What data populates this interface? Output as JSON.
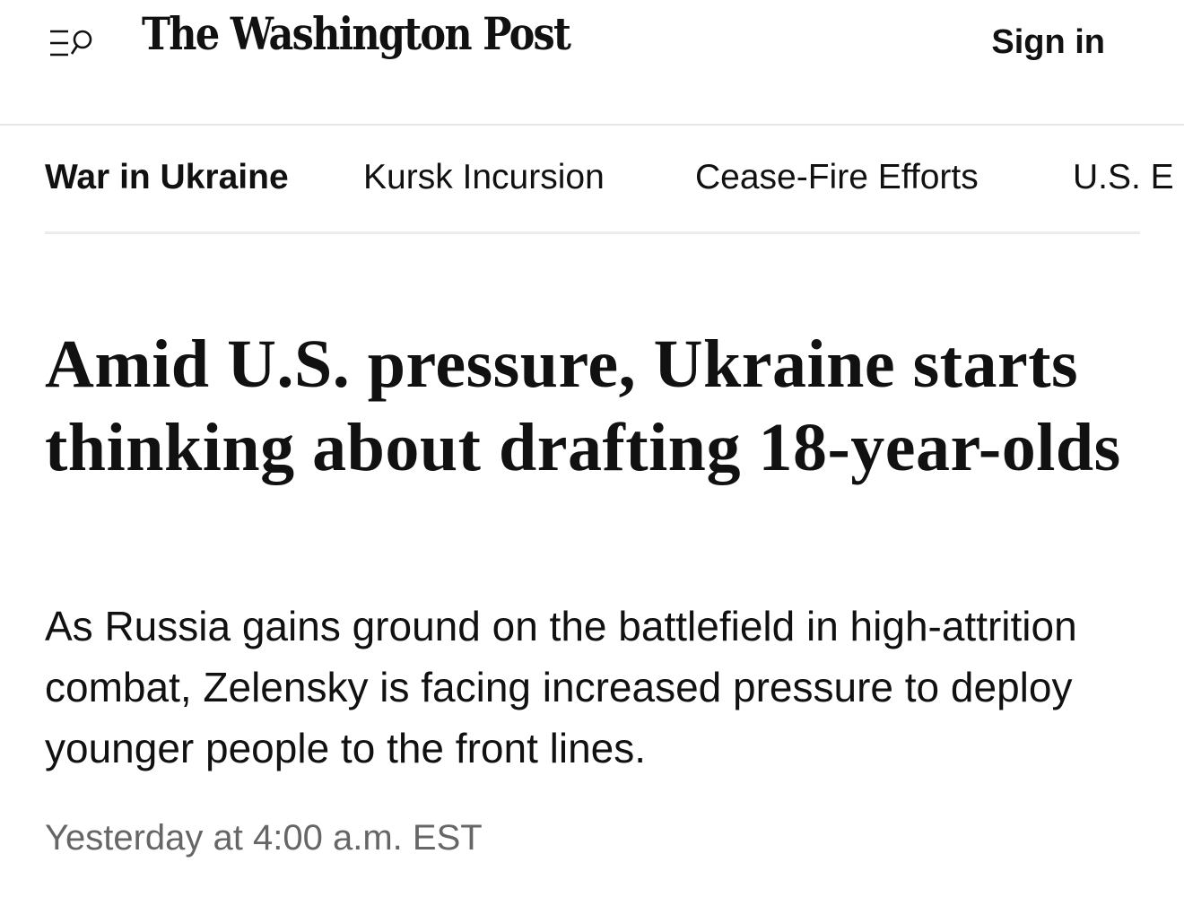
{
  "header": {
    "masthead": "The Washington Post",
    "sign_in_label": "Sign in",
    "menu_icon": "menu-search-icon"
  },
  "subnav": {
    "items": [
      {
        "label": "War in Ukraine",
        "active": true
      },
      {
        "label": "Kursk Incursion",
        "active": false
      },
      {
        "label": "Cease-Fire Efforts",
        "active": false
      },
      {
        "label": "U.S. E",
        "active": false
      }
    ]
  },
  "article": {
    "headline": "Amid U.S. pressure, Ukraine starts thinking about drafting 18-year-olds",
    "dek": "As Russia gains ground on the battlefield in high-attrition combat, Zelensky is facing increased pressure to deploy younger people to the front lines.",
    "timestamp": "Yesterday at 4:00 a.m. EST"
  },
  "colors": {
    "text": "#111111",
    "muted": "#666666",
    "divider": "#e6e6e6"
  }
}
